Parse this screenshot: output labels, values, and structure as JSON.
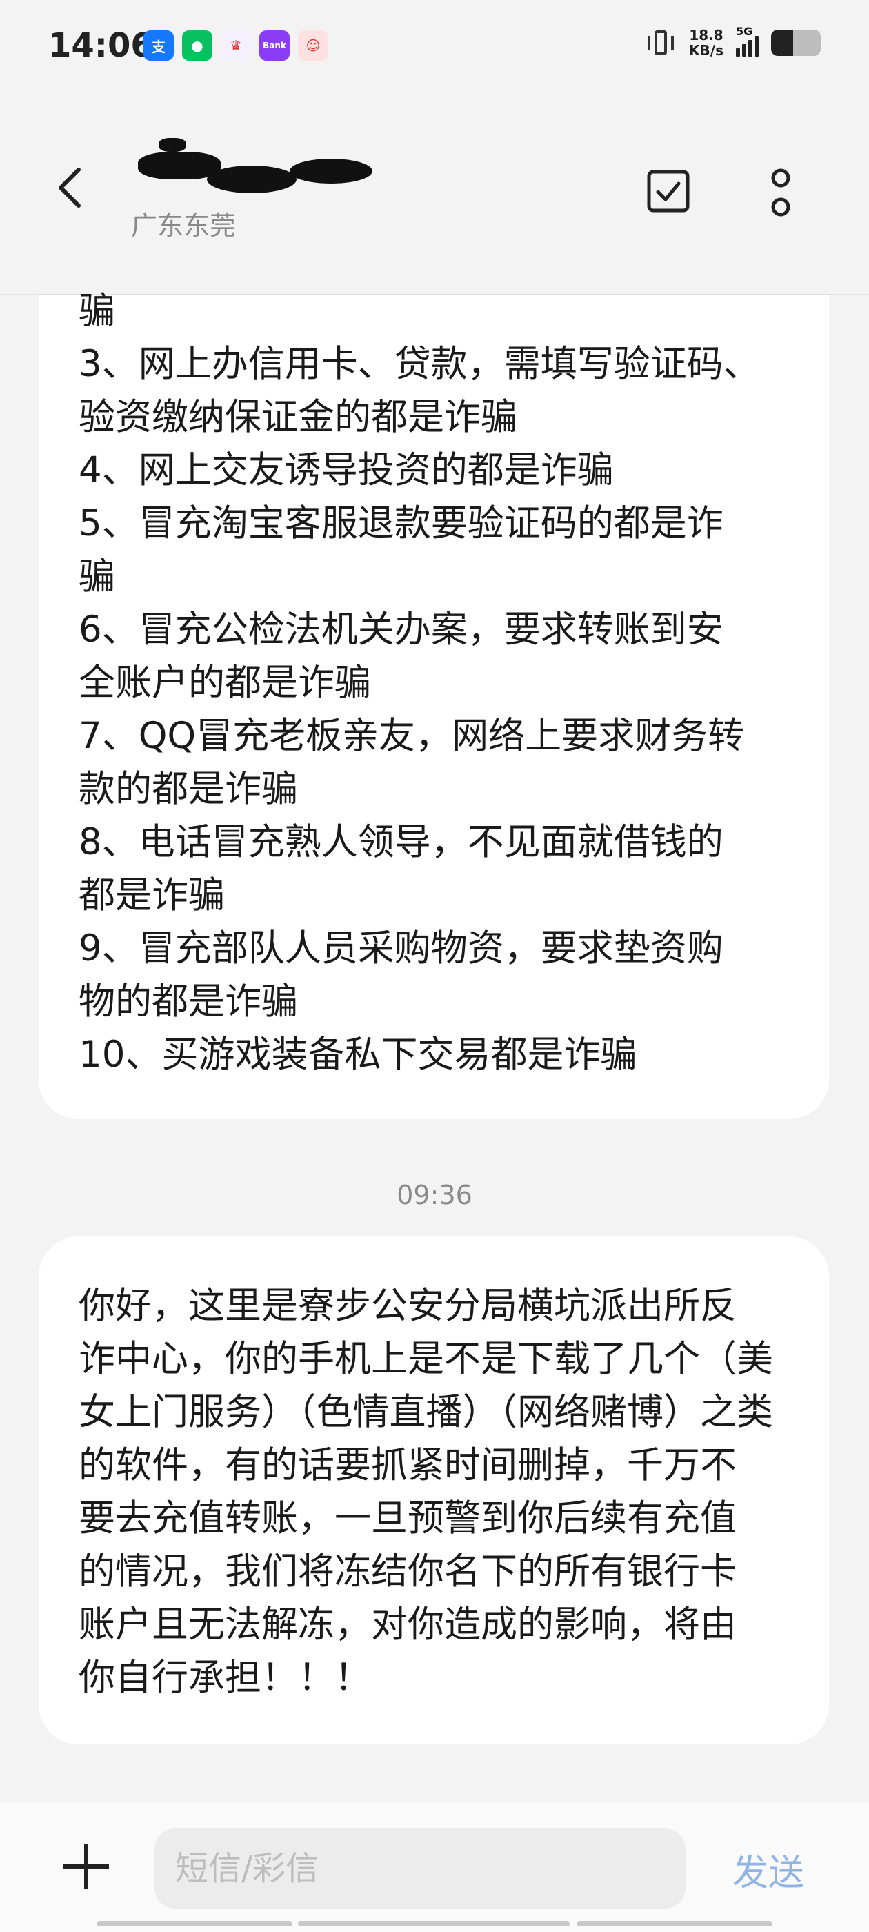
{
  "status_bar": {
    "time": "14:06",
    "net_speed_value": "18.8",
    "net_speed_unit": "KB/s",
    "network": "5G",
    "battery_level": 0.45,
    "app_icons": [
      {
        "name": "alipay-icon",
        "glyph": "支",
        "color": "#1677ff"
      },
      {
        "name": "wechat-icon",
        "glyph": "●",
        "color": "#07c160"
      },
      {
        "name": "crown-app-icon",
        "glyph": "♛",
        "color": "#f4f0ff"
      },
      {
        "name": "bank-app-icon",
        "glyph": "Bank",
        "color": "#8b3df5"
      },
      {
        "name": "clown-app-icon",
        "glyph": "☺",
        "color": "#ffe1e1"
      }
    ]
  },
  "header": {
    "contact_location": "广东东莞"
  },
  "messages": {
    "bubble1_lines": [
      "骗",
      "3、网上办信用卡、贷款，需填写验证码、",
      "验资缴纳保证金的都是诈骗",
      "4、网上交友诱导投资的都是诈骗",
      "5、冒充淘宝客服退款要验证码的都是诈",
      "骗",
      "6、冒充公检法机关办案，要求转账到安",
      "全账户的都是诈骗",
      "7、QQ冒充老板亲友，网络上要求财务转",
      "款的都是诈骗",
      "8、电话冒充熟人领导，不见面就借钱的",
      "都是诈骗",
      "9、冒充部队人员采购物资，要求垫资购",
      "物的都是诈骗",
      "10、买游戏装备私下交易都是诈骗"
    ],
    "timestamp": "09:36",
    "bubble2_lines": [
      "你好，这里是寮步公安分局横坑派出所反",
      "诈中心，你的手机上是不是下载了几个（美",
      "女上门服务）（色情直播）（网络赌博）之类",
      "的软件，有的话要抓紧时间删掉，千万不",
      "要去充值转账，一旦预警到你后续有充值",
      "的情况，我们将冻结你名下的所有银行卡",
      "账户且无法解冻，对你造成的影响，将由",
      "你自行承担！！！"
    ]
  },
  "input_bar": {
    "placeholder": "短信/彩信",
    "send_label": "发送"
  }
}
